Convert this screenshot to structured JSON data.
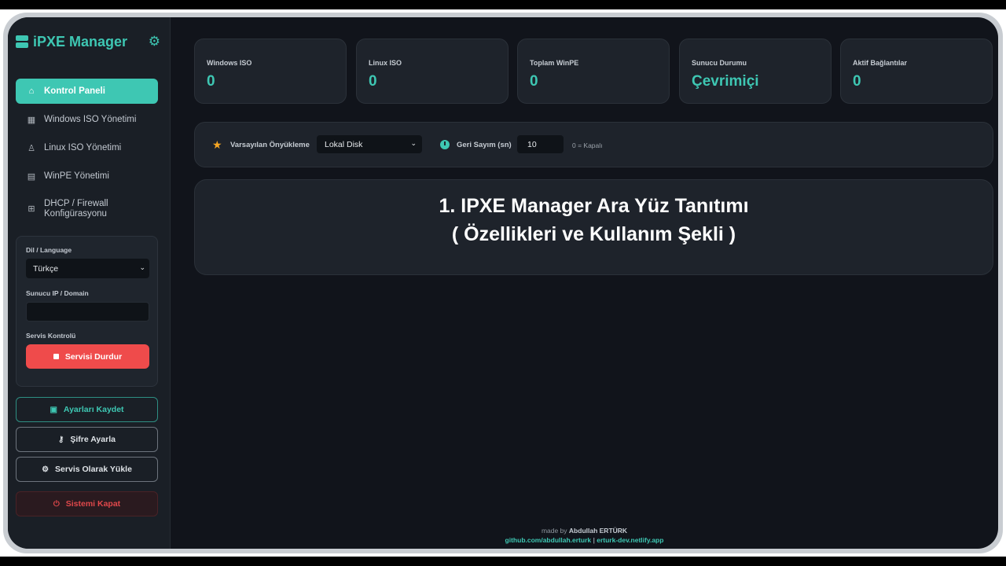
{
  "app": {
    "title": "iPXE Manager"
  },
  "sidebar": {
    "items": [
      {
        "label": "Kontrol Paneli",
        "icon": "home-icon"
      },
      {
        "label": "Windows ISO Yönetimi",
        "icon": "windows-icon"
      },
      {
        "label": "Linux ISO Yönetimi",
        "icon": "linux-icon"
      },
      {
        "label": "WinPE Yönetimi",
        "icon": "server-icon"
      },
      {
        "label_line1": "DHCP / Firewall",
        "label_line2": "Konfigürasyonu",
        "icon": "network-icon"
      }
    ],
    "settings": {
      "language_label": "Dil / Language",
      "language_value": "Türkçe",
      "server_label": "Sunucu IP / Domain",
      "server_value": "",
      "service_label": "Servis Kontrolü",
      "stop_button": "Servisi Durdur"
    },
    "buttons": {
      "save": "Ayarları Kaydet",
      "password": "Şifre Ayarla",
      "install_service": "Servis Olarak Yükle",
      "shutdown": "Sistemi Kapat"
    }
  },
  "stats": [
    {
      "label": "Windows ISO",
      "value": "0"
    },
    {
      "label": "Linux ISO",
      "value": "0"
    },
    {
      "label": "Toplam WinPE",
      "value": "0"
    },
    {
      "label": "Sunucu Durumu",
      "value": "Çevrimiçi"
    },
    {
      "label": "Aktif Bağlantılar",
      "value": "0"
    }
  ],
  "boot_options": {
    "default_label": "Varsayılan Önyükleme",
    "default_value": "Lokal Disk",
    "countdown_label": "Geri Sayım (sn)",
    "countdown_value": "10",
    "countdown_hint": "0 = Kapalı"
  },
  "banner": {
    "line1": "1. IPXE Manager Ara Yüz Tanıtımı",
    "line2": "( Özellikleri ve Kullanım Şekli )"
  },
  "footer": {
    "made_by_prefix": "made by",
    "author": "Abdullah ERTÜRK",
    "github": "github.com/abdullah.erturk",
    "separator": "|",
    "site": "erturk-dev.netlify.app"
  },
  "colors": {
    "accent": "#3ec7b3",
    "danger": "#ef4b4b",
    "background": "#11141b",
    "sidebar": "#1a1f26",
    "card": "#1e232b",
    "star": "#f6a623"
  }
}
